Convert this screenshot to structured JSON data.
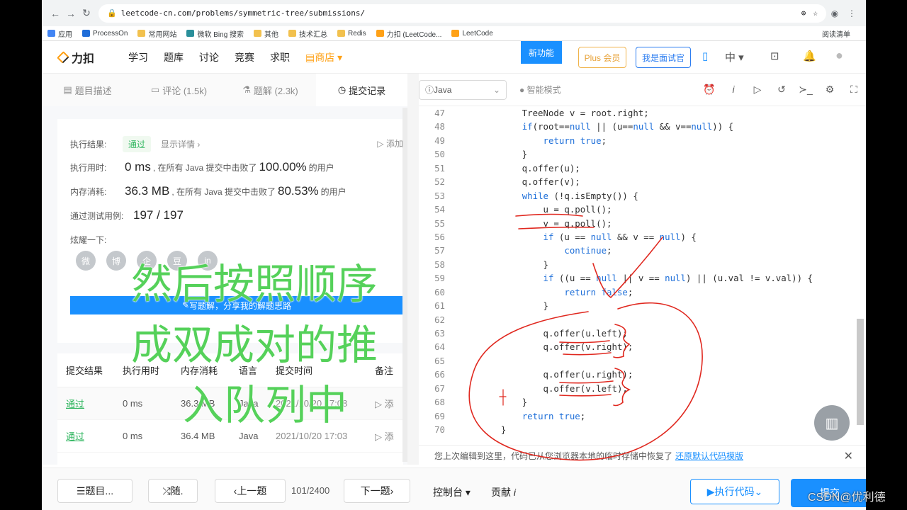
{
  "browser": {
    "url": "leetcode-cn.com/problems/symmetric-tree/submissions/",
    "bookmarks": [
      "应用",
      "ProcessOn",
      "常用网站",
      "微软 Bing 搜索",
      "其他",
      "技术汇总",
      "Redis",
      "力扣 (LeetCode...",
      "LeetCode"
    ],
    "reading_list": "阅读清单"
  },
  "site": {
    "logo": "力扣",
    "nav": [
      "学习",
      "题库",
      "讨论",
      "竞赛",
      "求职"
    ],
    "shop": "商店",
    "new_feature": "新功能",
    "plus": "Plus 会员",
    "interviewer": "我是面试官",
    "lang": "中"
  },
  "tabs": [
    {
      "label": "题目描述"
    },
    {
      "label": "评论 (1.5k)"
    },
    {
      "label": "题解 (2.3k)"
    },
    {
      "label": "提交记录"
    }
  ],
  "result": {
    "status_label": "执行结果:",
    "status": "通过",
    "detail": "显示详情 ›",
    "add": "添加",
    "time_label": "执行用时:",
    "time_value": "0 ms",
    "time_mid": ", 在所有 Java 提交中击败了",
    "time_pct": "100.00%",
    "users": "的用户",
    "mem_label": "内存消耗:",
    "mem_value": "36.3 MB",
    "mem_mid": ", 在所有 Java 提交中击败了",
    "mem_pct": "80.53%",
    "tests_label": "通过测试用例:",
    "tests_value": "197 / 197",
    "share": "炫耀一下:",
    "socials": [
      "微",
      "博",
      "企",
      "豆",
      "in"
    ],
    "bluebar": "写题解，分享我的解题思路"
  },
  "table": {
    "headers": [
      "提交结果",
      "执行用时",
      "内存消耗",
      "语言",
      "提交时间",
      "备注"
    ],
    "rows": [
      [
        "通过",
        "0 ms",
        "36.3 MB",
        "Java",
        "2021/10/20 17:08",
        "添"
      ],
      [
        "通过",
        "0 ms",
        "36.4 MB",
        "Java",
        "2021/10/20 17:03",
        "添"
      ]
    ]
  },
  "editor": {
    "language": "Java",
    "mode": "智能模式",
    "lines": [
      {
        "n": "47",
        "t": "        TreeNode v = root.right;"
      },
      {
        "n": "48",
        "t": "        if(root==null || (u==null && v==null)) {"
      },
      {
        "n": "49",
        "t": "            return true;"
      },
      {
        "n": "50",
        "t": "        }"
      },
      {
        "n": "51",
        "t": "        q.offer(u);"
      },
      {
        "n": "52",
        "t": "        q.offer(v);"
      },
      {
        "n": "53",
        "t": "        while (!q.isEmpty()) {"
      },
      {
        "n": "54",
        "t": "            u = q.poll();"
      },
      {
        "n": "55",
        "t": "            v = q.poll();"
      },
      {
        "n": "56",
        "t": "            if (u == null && v == null) {"
      },
      {
        "n": "57",
        "t": "                continue;"
      },
      {
        "n": "58",
        "t": "            }"
      },
      {
        "n": "59",
        "t": "            if ((u == null || v == null) || (u.val != v.val)) {"
      },
      {
        "n": "60",
        "t": "                return false;"
      },
      {
        "n": "61",
        "t": "            }"
      },
      {
        "n": "62",
        "t": ""
      },
      {
        "n": "63",
        "t": "            q.offer(u.left);"
      },
      {
        "n": "64",
        "t": "            q.offer(v.right);"
      },
      {
        "n": "65",
        "t": ""
      },
      {
        "n": "66",
        "t": "            q.offer(u.right);"
      },
      {
        "n": "67",
        "t": "            q.offer(v.left);"
      },
      {
        "n": "68",
        "t": "        }"
      },
      {
        "n": "69",
        "t": "        return true;"
      },
      {
        "n": "70",
        "t": "    }"
      }
    ],
    "notice": "您上次编辑到这里，代码已从您浏览器本地的临时存储中恢复了",
    "restore": "还原默认代码模版"
  },
  "bottom": {
    "list": "题目...",
    "random": "随.",
    "prev": "上一题",
    "page": "101/2400",
    "next": "下一题",
    "console": "控制台",
    "contribute": "贡献",
    "run": "执行代码",
    "submit": "提交"
  },
  "overlay": {
    "line1": "然后按照顺序",
    "line2": "成双成对的推",
    "line3": "入队列中"
  },
  "watermark": "CSDN@优利德"
}
